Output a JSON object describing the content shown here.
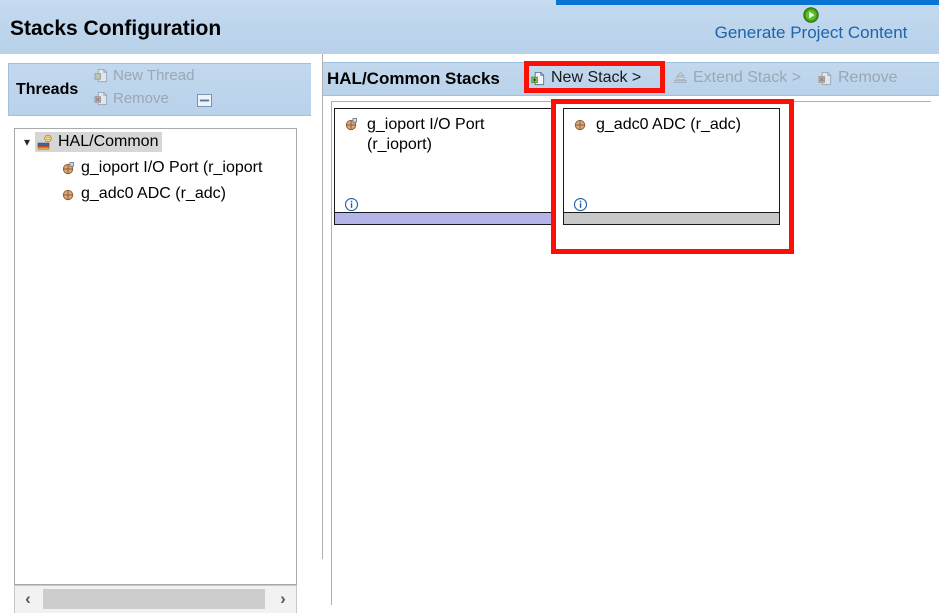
{
  "header": {
    "title": "Stacks Configuration",
    "generate_link": "Generate Project Content",
    "generate_icon": "green-play-icon",
    "accent_color": "#0a74d4",
    "background_color": "#bdd5ec"
  },
  "threads_panel": {
    "label": "Threads",
    "toolbar": [
      {
        "label": "New Thread",
        "icon": "new-page-icon",
        "enabled": false
      },
      {
        "label": "Remove",
        "icon": "remove-page-icon",
        "enabled": false
      }
    ],
    "collapse_icon": "collapse-all-icon",
    "tree": {
      "root": {
        "label": "HAL/Common",
        "icon": "hal-common-icon",
        "expander": "chevron-down-icon",
        "expanded": true,
        "selected": true,
        "children": [
          {
            "label": "g_ioport I/O Port (r_ioport",
            "icon": "module-icon"
          },
          {
            "label": "g_adc0 ADC (r_adc)",
            "icon": "module-icon"
          }
        ]
      }
    },
    "scrollbar": {
      "left_arrow": "‹",
      "right_arrow": "›"
    }
  },
  "stacks_panel": {
    "title": "HAL/Common Stacks",
    "toolbar": [
      {
        "label": "New Stack >",
        "icon": "new-stack-icon",
        "enabled": true,
        "highlighted": true
      },
      {
        "label": "Extend Stack >",
        "icon": "extend-stack-icon",
        "enabled": false,
        "highlighted": false
      },
      {
        "label": "Remove",
        "icon": "remove-stack-icon",
        "enabled": false,
        "highlighted": false
      }
    ],
    "stacks": [
      {
        "title": "g_ioport I/O Port (r_ioport)",
        "icon": "module-icon",
        "info_icon": "info-icon",
        "footer_color": "#b4b4e8",
        "highlighted": false
      },
      {
        "title": "g_adc0 ADC (r_adc)",
        "icon": "module-icon",
        "info_icon": "info-icon",
        "footer_color": "#c8c8c8",
        "highlighted": true
      }
    ]
  },
  "annotations": {
    "color": "#fc1005",
    "targets": [
      "new-stack-button",
      "adc-stack-box"
    ]
  }
}
